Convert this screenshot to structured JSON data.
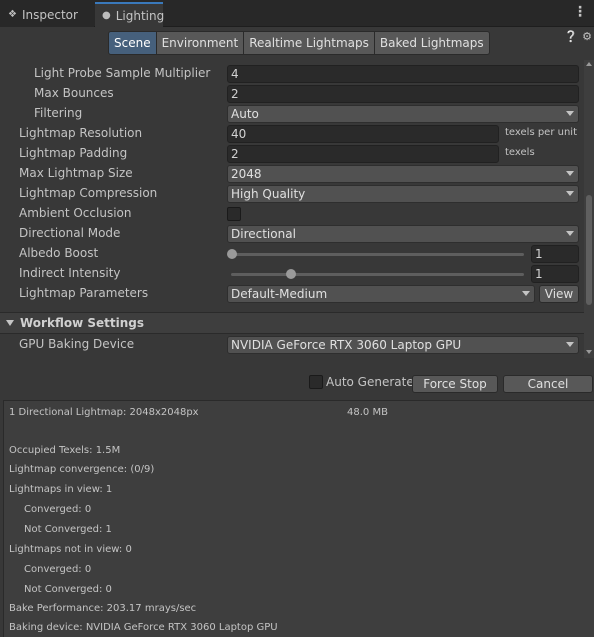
{
  "tabs": [
    {
      "label": "Inspector",
      "icon": "info-icon"
    },
    {
      "label": "Lighting",
      "icon": "lightbulb-icon"
    }
  ],
  "toolbar": {
    "segments": [
      "Scene",
      "Environment",
      "Realtime Lightmaps",
      "Baked Lightmaps"
    ],
    "selected": "Scene"
  },
  "settings": {
    "light_probe_sample_multiplier": {
      "label": "Light Probe Sample Multiplier",
      "value": "4"
    },
    "max_bounces": {
      "label": "Max Bounces",
      "value": "2"
    },
    "filtering": {
      "label": "Filtering",
      "value": "Auto"
    },
    "lightmap_resolution": {
      "label": "Lightmap Resolution",
      "value": "40",
      "unit": "texels per unit"
    },
    "lightmap_padding": {
      "label": "Lightmap Padding",
      "value": "2",
      "unit": "texels"
    },
    "max_lightmap_size": {
      "label": "Max Lightmap Size",
      "value": "2048"
    },
    "lightmap_compression": {
      "label": "Lightmap Compression",
      "value": "High Quality"
    },
    "ambient_occlusion": {
      "label": "Ambient Occlusion",
      "checked": false
    },
    "directional_mode": {
      "label": "Directional Mode",
      "value": "Directional"
    },
    "albedo_boost": {
      "label": "Albedo Boost",
      "value": "1",
      "slider_fraction": 0.0
    },
    "indirect_intensity": {
      "label": "Indirect Intensity",
      "value": "1",
      "slider_fraction": 0.2
    },
    "lightmap_parameters": {
      "label": "Lightmap Parameters",
      "value": "Default-Medium",
      "view_label": "View"
    }
  },
  "workflow": {
    "title": "Workflow Settings",
    "gpu_baking_device": {
      "label": "GPU Baking Device",
      "value": "NVIDIA GeForce RTX 3060 Laptop GPU"
    }
  },
  "bake": {
    "auto_generate_label": "Auto Generate",
    "auto_generate_checked": false,
    "force_stop_label": "Force Stop",
    "cancel_label": "Cancel"
  },
  "stats": {
    "lightmap_summary": "1 Directional Lightmap: 2048x2048px",
    "lightmap_size": "48.0 MB",
    "lines": [
      "Occupied Texels: 1.5M",
      "Lightmap convergence: (0/9)",
      "Lightmaps in view: 1",
      "Converged: 0",
      "Not Converged: 1",
      "Lightmaps not in view: 0",
      "Converged: 0",
      "Not Converged: 0",
      "Bake Performance: 203.17 mrays/sec",
      "Baking device: NVIDIA GeForce RTX 3060 Laptop GPU"
    ]
  },
  "colors": {
    "background": "#383838",
    "tab_active_accent": "#3a79bb",
    "segment_selected": "#46607c"
  }
}
